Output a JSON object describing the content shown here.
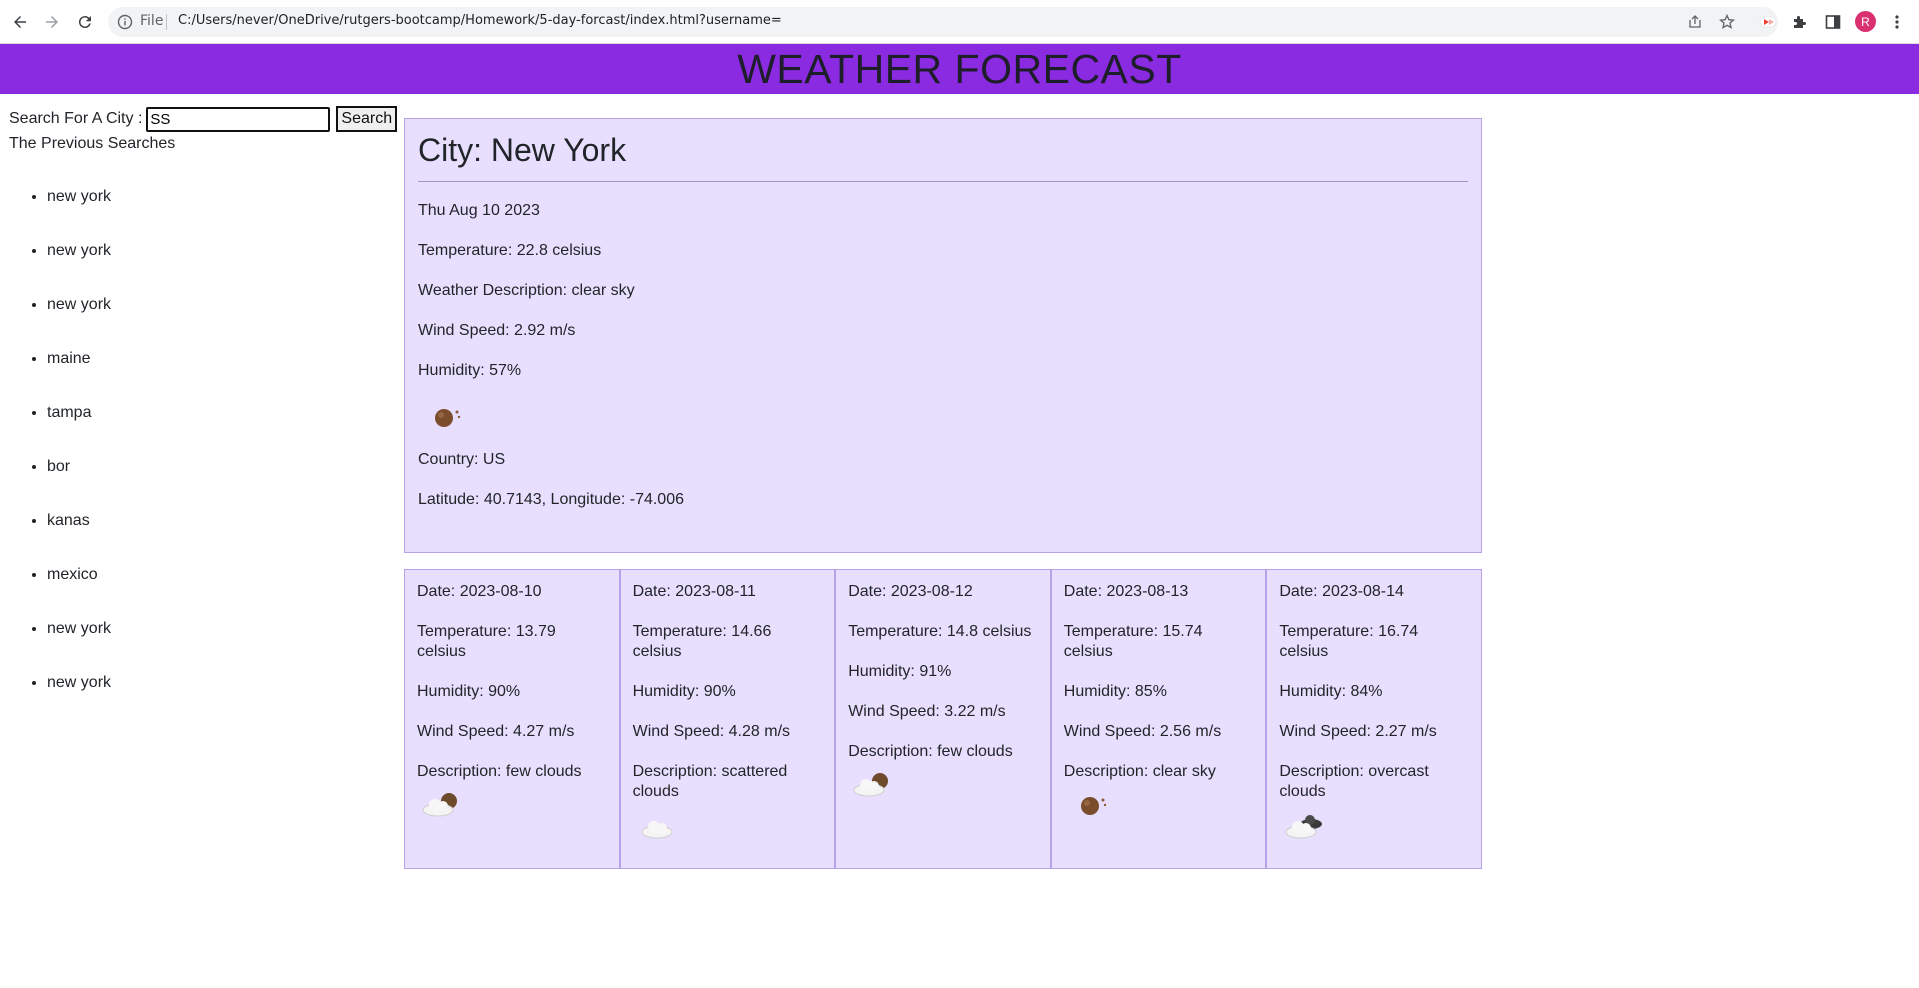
{
  "browser": {
    "file_label": "File",
    "url": "C:/Users/never/OneDrive/rutgers-bootcamp/Homework/5-day-forcast/index.html?username=",
    "avatar_letter": "R",
    "icons": [
      "back-arrow-icon",
      "forward-arrow-icon",
      "reload-icon",
      "info-icon",
      "share-icon",
      "star-icon",
      "extension-icon",
      "puzzle-icon",
      "side-panel-icon",
      "more-icon"
    ]
  },
  "header": {
    "title": "WEATHER FORECAST",
    "color": "#8a2be2"
  },
  "search": {
    "label": "Search For A City :",
    "value": "SS",
    "button": "Search"
  },
  "history": {
    "title": "The Previous Searches",
    "items": [
      "new york",
      "new york",
      "new york",
      "maine",
      "tampa",
      "bor",
      "kanas",
      "mexico",
      "new york",
      "new york"
    ]
  },
  "current": {
    "city": "City: New York",
    "date": "Thu Aug 10 2023",
    "temperature": "Temperature: 22.8 celsius",
    "description": "Weather Description: clear sky",
    "wind": "Wind Speed: 2.92 m/s",
    "humidity": "Humidity: 57%",
    "icon": "clear-sky-icon",
    "country": "Country: US",
    "coords": "Latitude: 40.7143, Longitude: -74.006"
  },
  "forecast": [
    {
      "date": "Date: 2023-08-10",
      "temp": "Temperature: 13.79 celsius",
      "humidity": "Humidity: 90%",
      "wind": "Wind Speed: 4.27 m/s",
      "desc": "Description: few clouds",
      "icon": "few-clouds-icon"
    },
    {
      "date": "Date: 2023-08-11",
      "temp": "Temperature: 14.66 celsius",
      "humidity": "Humidity: 90%",
      "wind": "Wind Speed: 4.28 m/s",
      "desc": "Description: scattered clouds",
      "icon": "scattered-clouds-icon"
    },
    {
      "date": "Date: 2023-08-12",
      "temp": "Temperature: 14.8 celsius",
      "humidity": "Humidity: 91%",
      "wind": "Wind Speed: 3.22 m/s",
      "desc": "Description: few clouds",
      "icon": "few-clouds-icon"
    },
    {
      "date": "Date: 2023-08-13",
      "temp": "Temperature: 15.74 celsius",
      "humidity": "Humidity: 85%",
      "wind": "Wind Speed: 2.56 m/s",
      "desc": "Description: clear sky",
      "icon": "clear-sky-icon"
    },
    {
      "date": "Date: 2023-08-14",
      "temp": "Temperature: 16.74 celsius",
      "humidity": "Humidity: 84%",
      "wind": "Wind Speed: 2.27 m/s",
      "desc": "Description: overcast clouds",
      "icon": "overcast-clouds-icon"
    }
  ]
}
